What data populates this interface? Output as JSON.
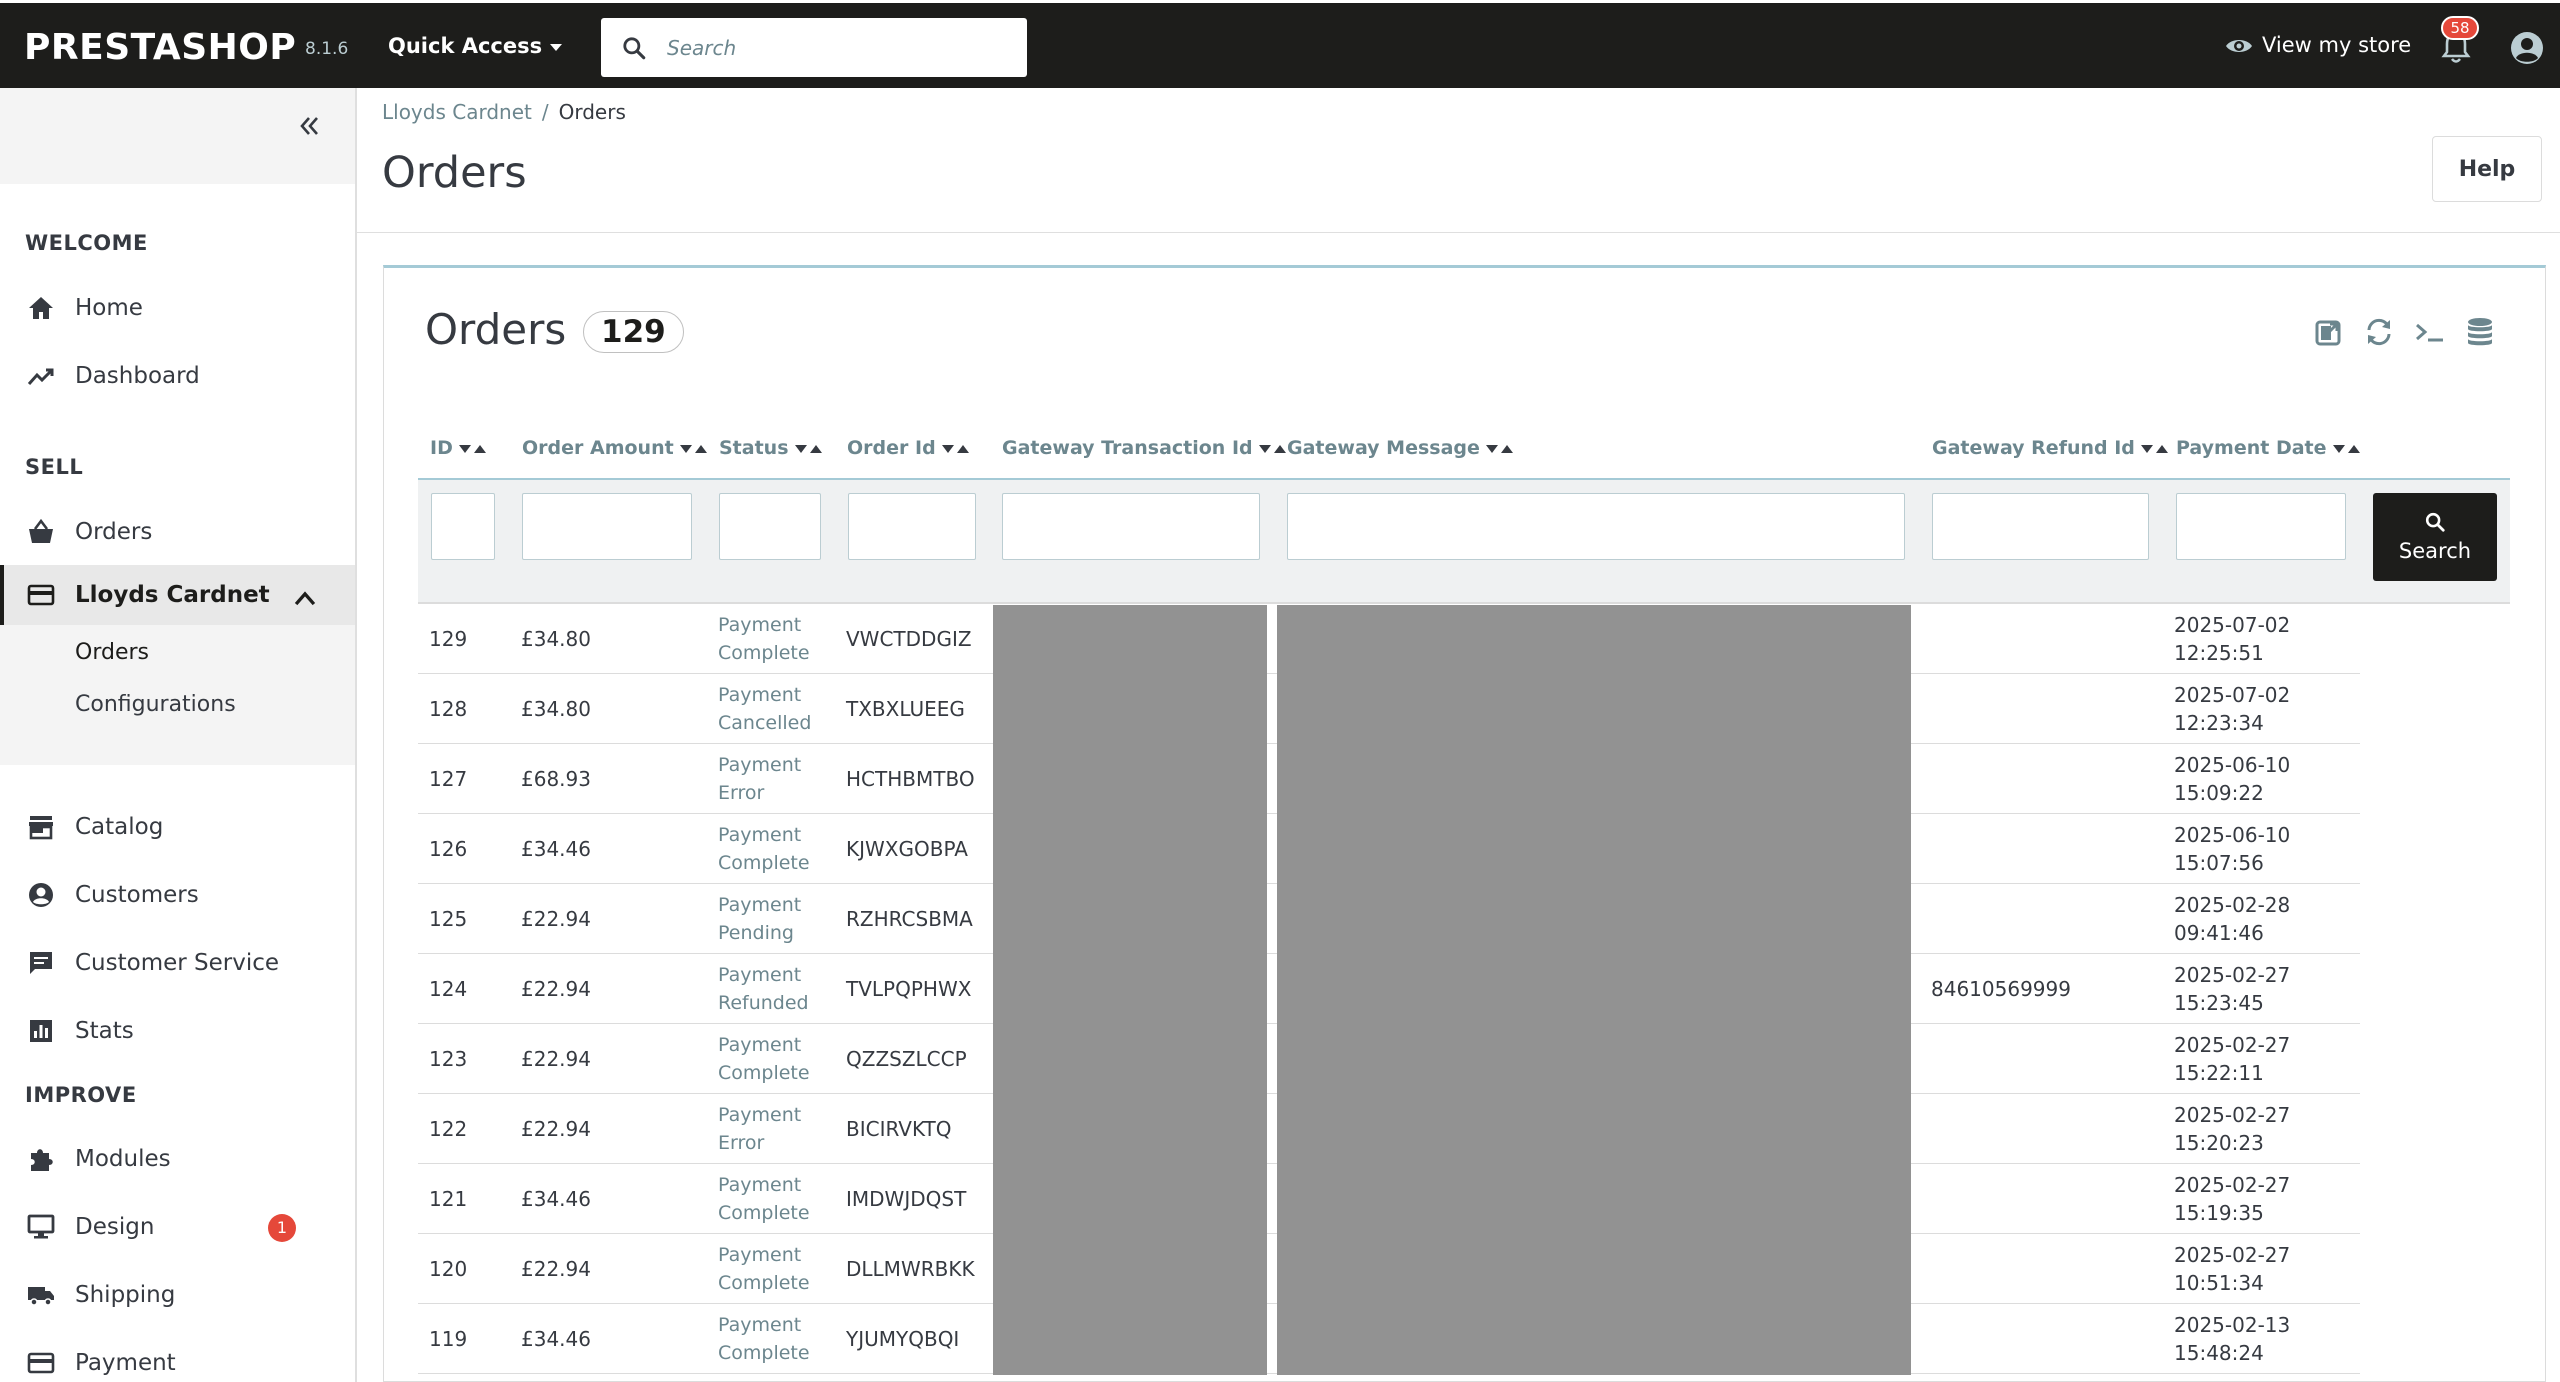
{
  "topbar": {
    "logo": "PRESTASHOP",
    "version": "8.1.6",
    "quick_access": "Quick Access",
    "search_placeholder": "Search",
    "view_store": "View my store",
    "notifications_count": "58"
  },
  "sidebar": {
    "sections": {
      "welcome": "WELCOME",
      "sell": "SELL",
      "improve": "IMPROVE"
    },
    "items": {
      "home": "Home",
      "dashboard": "Dashboard",
      "orders": "Orders",
      "lloyds": "Lloyds Cardnet",
      "lloyds_orders": "Orders",
      "lloyds_configurations": "Configurations",
      "catalog": "Catalog",
      "customers": "Customers",
      "customer_service": "Customer Service",
      "stats": "Stats",
      "modules": "Modules",
      "design": "Design",
      "design_badge": "1",
      "shipping": "Shipping",
      "payment": "Payment"
    }
  },
  "header": {
    "breadcrumb_parent": "Lloyds Cardnet",
    "breadcrumb_sep": "/",
    "breadcrumb_current": "Orders",
    "title": "Orders",
    "help_label": "Help"
  },
  "panel": {
    "title": "Orders",
    "count": "129",
    "search_label": "Search"
  },
  "columns": {
    "id": "ID",
    "amount": "Order Amount",
    "status": "Status",
    "order_id": "Order Id",
    "gateway_txn": "Gateway Transaction Id",
    "gateway_msg": "Gateway Message",
    "gateway_refund": "Gateway Refund Id",
    "payment_date": "Payment Date"
  },
  "rows": [
    {
      "id": "129",
      "amount": "£34.80",
      "status1": "Payment",
      "status2": "Complete",
      "order_id": "VWCTDDGIZ",
      "refund": "",
      "date": "2025-07-02",
      "time": "12:25:51"
    },
    {
      "id": "128",
      "amount": "£34.80",
      "status1": "Payment",
      "status2": "Cancelled",
      "order_id": "TXBXLUEEG",
      "refund": "",
      "date": "2025-07-02",
      "time": "12:23:34"
    },
    {
      "id": "127",
      "amount": "£68.93",
      "status1": "Payment",
      "status2": "Error",
      "order_id": "HCTHBMTBO",
      "refund": "",
      "date": "2025-06-10",
      "time": "15:09:22"
    },
    {
      "id": "126",
      "amount": "£34.46",
      "status1": "Payment",
      "status2": "Complete",
      "order_id": "KJWXGOBPA",
      "refund": "",
      "date": "2025-06-10",
      "time": "15:07:56"
    },
    {
      "id": "125",
      "amount": "£22.94",
      "status1": "Payment",
      "status2": "Pending",
      "order_id": "RZHRCSBMA",
      "refund": "",
      "date": "2025-02-28",
      "time": "09:41:46"
    },
    {
      "id": "124",
      "amount": "£22.94",
      "status1": "Payment",
      "status2": "Refunded",
      "order_id": "TVLPQPHWX",
      "refund": "84610569999",
      "date": "2025-02-27",
      "time": "15:23:45"
    },
    {
      "id": "123",
      "amount": "£22.94",
      "status1": "Payment",
      "status2": "Complete",
      "order_id": "QZZSZLCCP",
      "refund": "",
      "date": "2025-02-27",
      "time": "15:22:11"
    },
    {
      "id": "122",
      "amount": "£22.94",
      "status1": "Payment",
      "status2": "Error",
      "order_id": "BICIRVKTQ",
      "refund": "",
      "date": "2025-02-27",
      "time": "15:20:23"
    },
    {
      "id": "121",
      "amount": "£34.46",
      "status1": "Payment",
      "status2": "Complete",
      "order_id": "IMDWJDQST",
      "refund": "",
      "date": "2025-02-27",
      "time": "15:19:35"
    },
    {
      "id": "120",
      "amount": "£22.94",
      "status1": "Payment",
      "status2": "Complete",
      "order_id": "DLLMWRBKK",
      "refund": "",
      "date": "2025-02-27",
      "time": "10:51:34"
    },
    {
      "id": "119",
      "amount": "£34.46",
      "status1": "Payment",
      "status2": "Complete",
      "order_id": "YJUMYQBQI",
      "refund": "",
      "date": "2025-02-13",
      "time": "15:48:24"
    }
  ]
}
